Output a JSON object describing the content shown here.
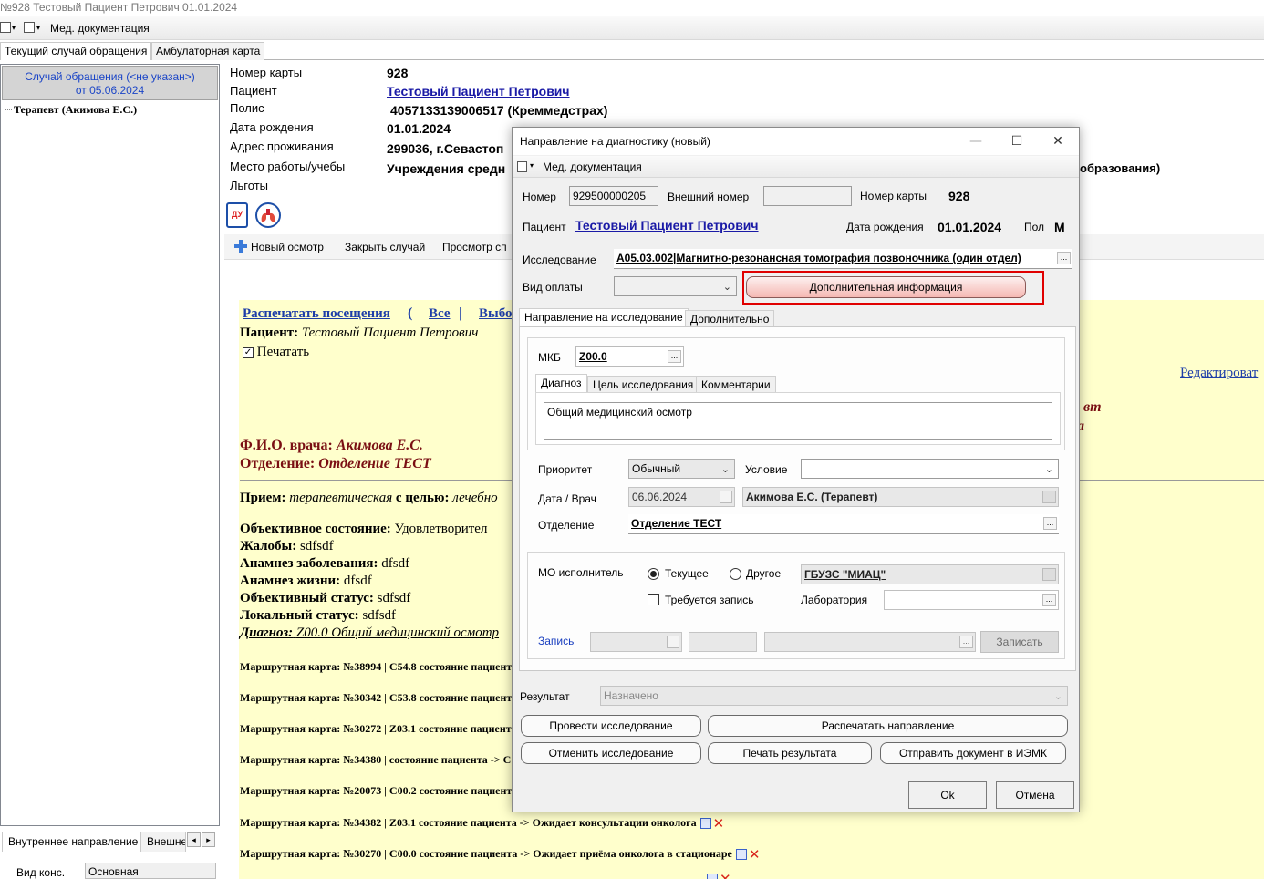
{
  "window": {
    "title": "№928 Тестовый Пациент Петрович 01.01.2024",
    "toolbar_label": "Мед. документация",
    "tabs": [
      "Текущий случай обращения",
      "Амбулаторная карта"
    ]
  },
  "left_panel": {
    "case_line1": "Случай обращения (<не указан>)",
    "case_line2": "от 05.06.2024",
    "tree_node": "Терапевт (Акимова Е.С.)",
    "bottom_tabs": [
      "Внутреннее направление",
      "Внешне"
    ],
    "vid_label": "Вид конс.",
    "vid_value": "Основная"
  },
  "patient": {
    "labels": [
      "Номер карты",
      "Пациент",
      "Полис",
      "Дата рождения",
      "Адрес проживания",
      "Место работы/учебы",
      "Льготы"
    ],
    "card_no": "928",
    "name": "Тестовый Пациент Петрович",
    "policy": "4057133139006517 (Креммедстрах)",
    "birth": "01.01.2024",
    "address": "299036, г.Севастоп",
    "work": "Учреждения средн",
    "work_tail": "образования)",
    "icon_du": "ДУ"
  },
  "actions": {
    "new_exam": "Новый осмотр",
    "close_case": "Закрыть случай",
    "view": "Просмотр сп"
  },
  "report": {
    "print_visits": "Распечатать посещения",
    "paren": "(",
    "all": "Все",
    "pipe": "|",
    "select": "Выбо",
    "patient_label": "Пациент:",
    "patient_value": "Тестовый Пациент Петрович",
    "print_chk": "Печатать",
    "edit_link": "Редактироват",
    "right_frag1": "вт",
    "right_frag2": "а",
    "doctor_label": "Ф.И.О. врача:",
    "doctor_value": "Акимова Е.С.",
    "dept_label": "Отделение:",
    "dept_value": "Отделение ТЕСТ",
    "reception_label": "Прием:",
    "reception_value": "терапевтическая",
    "purpose_label": "с целью:",
    "purpose_value": "лечебно",
    "objective_label": "Объективное состояние:",
    "objective_value": "Удовлетворител",
    "complaints_label": "Жалобы:",
    "complaints_value": "sdfsdf",
    "anamnesis_label": "Анамнез заболевания:",
    "anamnesis_value": "dfsdf",
    "life_label": "Анамнез жизни:",
    "life_value": "dfsdf",
    "status_label": "Объективный статус:",
    "status_value": "sdfsdf",
    "local_label": "Локальный статус:",
    "local_value": "sdfsdf",
    "diagnosis_label": "Диагноз:",
    "diagnosis_value": "Z00.0 Общий медицинский осмотр",
    "routes": [
      "Маршрутная карта: №38994 | C54.8 состояние пациент",
      "Маршрутная карта: №30342 | C53.8 состояние пациент",
      "Маршрутная карта: №30272 | Z03.1 состояние пациент",
      "Маршрутная карта: №34380 | состояние пациента -> С",
      "Маршрутная карта: №20073 | C00.2 состояние пациент",
      "Маршрутная карта: №34382 | Z03.1 состояние пациента -> Ожидает консультации онколога",
      "Маршрутная карта: №30270 | C00.0 состояние пациента -> Ожидает приёма онколога в стационаре"
    ]
  },
  "dialog": {
    "title": "Направление на диагностику (новый)",
    "toolbar_label": "Мед. документация",
    "number_label": "Номер",
    "number_value": "929500000205",
    "ext_label": "Внешний номер",
    "ext_value": "",
    "card_label": "Номер карты",
    "card_value": "928",
    "patient_label": "Пациент",
    "patient_value": "Тестовый Пациент Петрович",
    "birth_label": "Дата рождения",
    "birth_value": "01.01.2024",
    "sex_label": "Пол",
    "sex_value": "М",
    "study_label": "Исследование",
    "study_value": "A05.03.002|Магнитно-резонансная томография позвоночника (один отдел)",
    "payment_label": "Вид оплаты",
    "payment_value": "",
    "extra_info_button": "Дополнительная информация",
    "tabs": [
      "Направление на исследование",
      "Дополнительно"
    ],
    "mkb_label": "МКБ",
    "mkb_value": "Z00.0",
    "inner_tabs": [
      "Диагноз",
      "Цель исследования",
      "Комментарии"
    ],
    "diagnosis_text": "Общий медицинский осмотр",
    "priority_label": "Приоритет",
    "priority_value": "Обычный",
    "condition_label": "Условие",
    "condition_value": "",
    "date_label": "Дата / Врач",
    "date_value": "06.06.2024",
    "doctor_value": "Акимова Е.С. (Терапевт)",
    "dept_label": "Отделение",
    "dept_value": "Отделение ТЕСТ",
    "mo_label": "МО исполнитель",
    "radio_current": "Текущее",
    "radio_other": "Другое",
    "mo_value": "ГБУЗС \"МИАЦ\"",
    "need_record": "Требуется запись",
    "lab_label": "Лаборатория",
    "lab_value": "",
    "record_link": "Запись",
    "record_button": "Записать",
    "result_label": "Результат",
    "result_value": "Назначено",
    "btn_conduct": "Провести исследование",
    "btn_print_dir": "Распечатать направление",
    "btn_cancel_study": "Отменить исследование",
    "btn_print_result": "Печать результата",
    "btn_send": "Отправить документ в ИЭМК",
    "btn_ok": "Ok",
    "btn_cancel": "Отмена"
  },
  "colors": {
    "highlight_border": "#e00000",
    "report_bg": "#ffffcc",
    "link": "#1a1aa6",
    "maroon": "#7a0f13"
  }
}
